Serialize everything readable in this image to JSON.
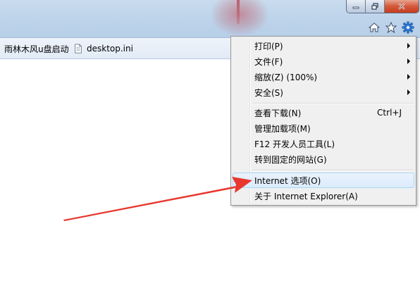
{
  "favorites_bar": {
    "items": [
      {
        "label": "雨林木风u盘启动",
        "icon": "page-icon"
      },
      {
        "label": "desktop.ini",
        "icon": "file-icon"
      }
    ]
  },
  "tools_menu": {
    "items": [
      {
        "label": "打印(P)",
        "submenu": true
      },
      {
        "label": "文件(F)",
        "submenu": true
      },
      {
        "label": "缩放(Z) (100%)",
        "submenu": true
      },
      {
        "label": "安全(S)",
        "submenu": true
      },
      {
        "label": "查看下载(N)",
        "shortcut": "Ctrl+J"
      },
      {
        "label": "管理加载项(M)"
      },
      {
        "label": "F12 开发人员工具(L)"
      },
      {
        "label": "转到固定的网站(G)"
      },
      {
        "label": "Internet 选项(O)"
      },
      {
        "label": "关于 Internet Explorer(A)"
      }
    ]
  },
  "colors": {
    "annotation_arrow": "#e8372e",
    "menu_highlight_border": "#a8d8f5",
    "close_button": "#c53c1f"
  }
}
